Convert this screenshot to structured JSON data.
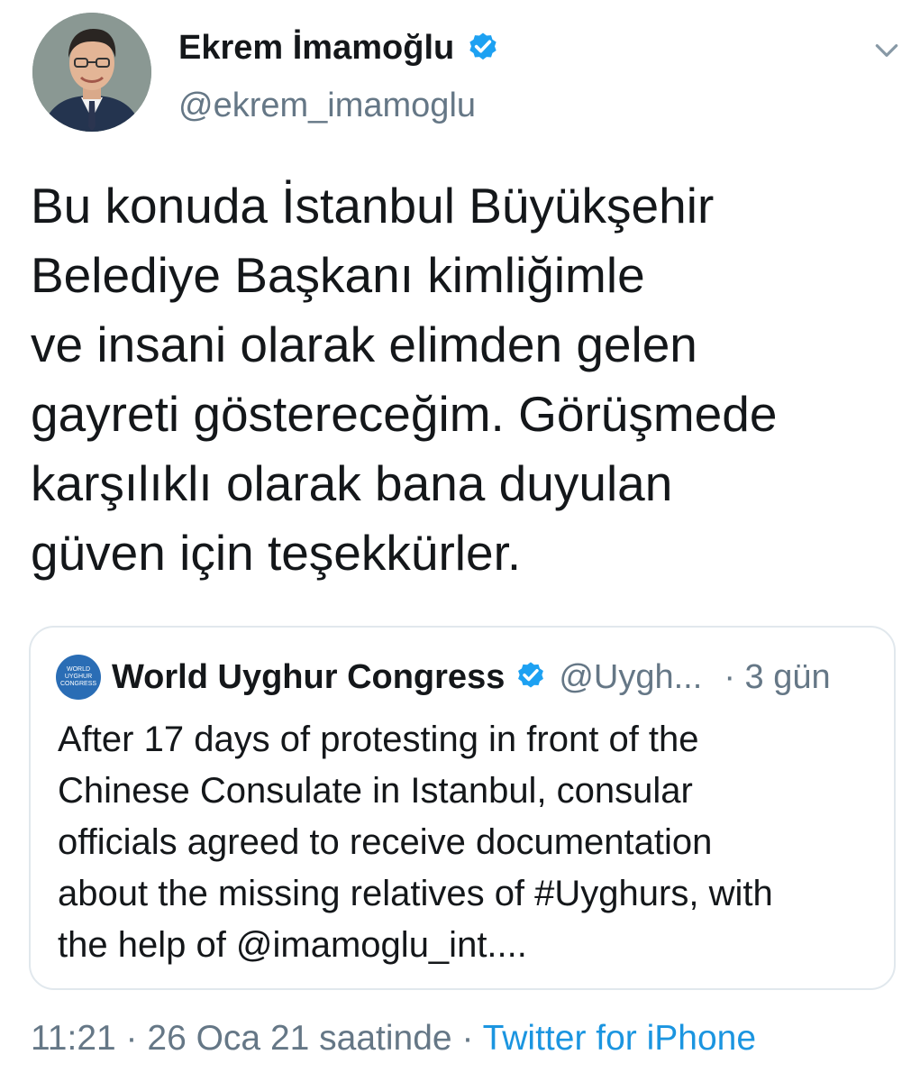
{
  "tweet": {
    "author": {
      "display_name": "Ekrem İmamoğlu",
      "handle": "@ekrem_imamoglu",
      "verified": true,
      "avatar_icon": "profile-photo"
    },
    "text": "Bu konuda İstanbul Büyükşehir\nBelediye Başkanı kimliğimle\nve insani olarak elimden gelen\ngayreti göstereceğim. Görüşmede\nkarşılıklı olarak bana duyulan\ngüven için teşekkürler.",
    "quoted": {
      "logo_text": [
        "WORLD",
        "UYGHUR",
        "CONGRESS"
      ],
      "display_name": "World Uyghur Congress",
      "verified": true,
      "handle": "@Uygh...",
      "time": "· 3 gün",
      "text": "After 17 days of protesting in front of the\nChinese Consulate in Istanbul, consular\nofficials agreed to receive documentation\nabout the missing relatives of #Uyghurs, with\nthe help of @imamoglu_int...."
    },
    "footer": {
      "time": "11:21",
      "sep1": " · ",
      "date": "26 Oca 21 saatinde",
      "sep2": " · ",
      "source": "Twitter for iPhone"
    }
  },
  "colors": {
    "accent": "#1b95e0",
    "verified": "#1da1f2",
    "secondary_text": "#657786",
    "border": "#e1e8ed"
  },
  "icons": {
    "verified": "verified-badge-icon",
    "menu": "chevron-down-icon"
  }
}
